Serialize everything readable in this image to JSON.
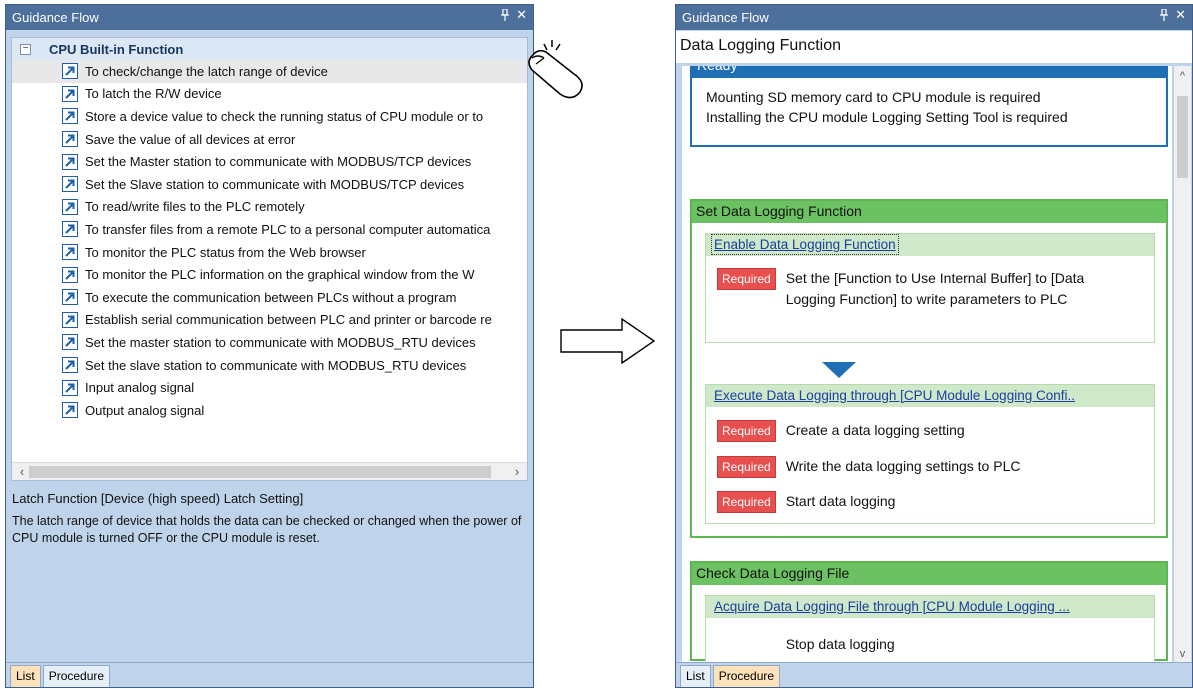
{
  "left_panel": {
    "title": "Guidance Flow",
    "pin_icon": "pin-icon",
    "close_icon": "close-icon",
    "tree_root": "CPU Built-in Function",
    "tree_toggle": "⊟",
    "items": [
      "To check/change the latch range of device",
      "To latch the R/W device",
      "Store a device value to check the running status of CPU module or to",
      "Save the value of all devices at error",
      "Set the Master station to communicate with MODBUS/TCP devices",
      "Set the Slave station to communicate with MODBUS/TCP devices",
      "To read/write files to the PLC remotely",
      "To transfer files from a remote PLC to a personal computer automatica",
      "To monitor the PLC status from the Web browser",
      "To monitor the PLC information on the graphical window from the W",
      "To execute the communication between PLCs without a program",
      "Establish serial communication between PLC and printer or barcode re",
      "Set the master station to communicate with MODBUS_RTU devices",
      "Set the slave station to communicate with MODBUS_RTU devices",
      "Input analog signal",
      "Output analog signal"
    ],
    "scroll_left": "‹",
    "scroll_right": "›",
    "desc_title": "Latch Function [Device (high speed) Latch Setting]",
    "desc_text": "The latch range of device that holds the data can be checked or changed when the power of CPU module is turned OFF or the CPU module is reset.",
    "tabs": [
      "List",
      "Procedure"
    ]
  },
  "right_panel": {
    "title": "Guidance Flow",
    "flow_title": "Data Logging Function",
    "ready": {
      "header": "Ready",
      "lines": [
        "Mounting SD memory card to CPU module is required",
        "Installing the CPU module Logging Setting Tool is required"
      ]
    },
    "set_section": {
      "header": "Set Data Logging Function",
      "step1": {
        "link": "Enable Data Logging Function",
        "badge": "Required",
        "text": "Set the [Function to Use Internal Buffer] to [Data Logging Function] to write parameters to PLC"
      },
      "step2": {
        "link": "Execute Data Logging through [CPU Module Logging Confi..",
        "rows": [
          {
            "badge": "Required",
            "text": "Create a data logging setting"
          },
          {
            "badge": "Required",
            "text": "Write the data logging settings to PLC"
          },
          {
            "badge": "Required",
            "text": "Start data logging"
          }
        ]
      }
    },
    "check_section": {
      "header": "Check Data Logging File",
      "link": "Acquire Data Logging File through [CPU Module Logging ...",
      "row": "Stop data logging"
    },
    "scroll_up": "^",
    "scroll_down": "v",
    "tabs": [
      "List",
      "Procedure"
    ]
  },
  "colors": {
    "title_bar": "#4c6f9c",
    "ready_blue": "#1f6fb6",
    "section_green": "#6cc262",
    "required_red": "#e84f4f",
    "active_tab": "#fde1b9"
  }
}
